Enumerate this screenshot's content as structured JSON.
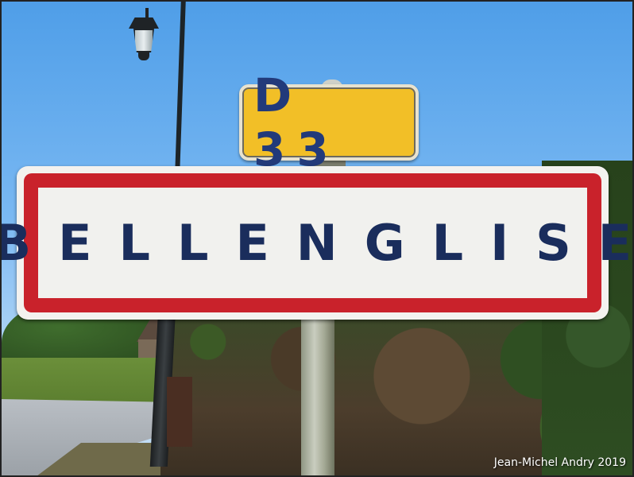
{
  "scene": {
    "route_sign": {
      "text": "D 33",
      "background_color": "#f2bf27",
      "text_color": "#223a7a"
    },
    "town_sign": {
      "text": "BELLENGLISE",
      "border_color": "#c9222b",
      "text_color": "#1a2d5c"
    },
    "watermark": "Jean-Michel Andry 2019"
  }
}
